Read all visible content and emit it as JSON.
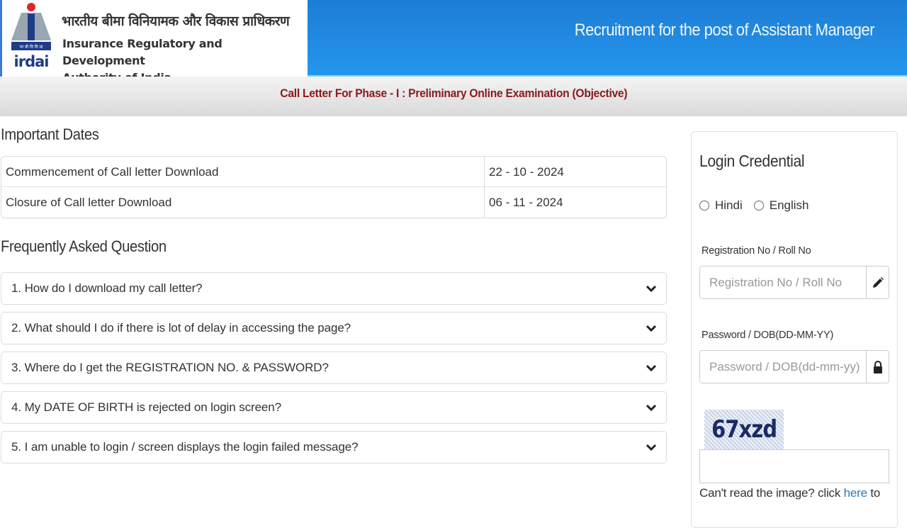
{
  "header": {
    "org_hindi": "भारतीय बीमा विनियामक और विकास प्राधिकरण",
    "org_english_line1": "Insurance Regulatory and Development",
    "org_english_line2": "Authority of India",
    "logo_text": "irdai",
    "logo_hindi_band": "भा बी वि वि प्रा",
    "banner_title": "Recruitment for the post of Assistant Manager"
  },
  "subheader": {
    "title": "Call Letter For Phase - I : Preliminary Online Examination (Objective)"
  },
  "important_dates": {
    "title": "Important Dates",
    "rows": [
      {
        "label": "Commencement of Call letter Download",
        "value": "22 - 10 - 2024"
      },
      {
        "label": "Closure of Call letter Download",
        "value": "06 - 11 - 2024"
      }
    ]
  },
  "faq": {
    "title": "Frequently Asked Question",
    "items": [
      {
        "question": "1. How do I download my call letter?"
      },
      {
        "question": "2. What should I do if there is lot of delay in accessing the page?"
      },
      {
        "question": "3. Where do I get the REGISTRATION NO. & PASSWORD?"
      },
      {
        "question": "4. My DATE OF BIRTH is rejected on login screen?"
      },
      {
        "question": "5. I am unable to login / screen displays the login failed message?"
      }
    ]
  },
  "login": {
    "title": "Login Credential",
    "language_options": [
      "Hindi",
      "English"
    ],
    "registration_label": "Registration No / Roll No",
    "registration_placeholder": "Registration No / Roll No",
    "registration_value": "",
    "password_label": "Password / DOB(DD-MM-YY)",
    "password_placeholder": "Password / DOB(dd-mm-yy)",
    "password_value": "",
    "captcha_text": "67xzd",
    "captcha_input_value": "",
    "captcha_help_prefix": "Can't read the image? click ",
    "captcha_help_link": "here",
    "captcha_help_suffix": " to"
  },
  "colors": {
    "banner_blue": "#2496ee",
    "subheader_title": "#8b1a1a",
    "link": "#2a7ab8",
    "logo_red": "#e0262b",
    "logo_navy": "#1f3c88"
  }
}
